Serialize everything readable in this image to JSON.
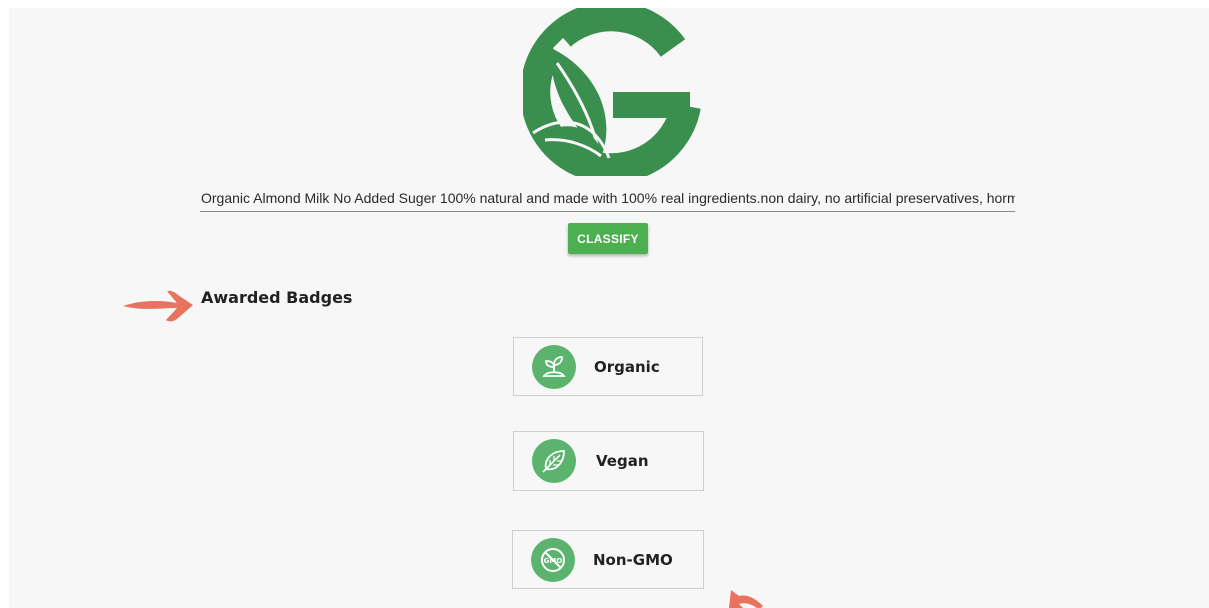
{
  "input": {
    "value": "Organic Almond Milk No Added Suger 100% natural and made with 100% real ingredients.non dairy, no artificial preservatives, hormones, and"
  },
  "actions": {
    "classify_label": "CLASSIFY"
  },
  "badges_section": {
    "title": "Awarded Badges",
    "badges": [
      {
        "label": "Organic",
        "icon": "sprout-icon"
      },
      {
        "label": "Vegan",
        "icon": "leaf-icon"
      },
      {
        "label": "Non-GMO",
        "icon": "no-gmo-icon"
      }
    ]
  },
  "colors": {
    "brand_green": "#3a8f4f",
    "button_green": "#4caf50",
    "badge_icon_green": "#5bb36e",
    "annotation_arrow": "#e8735f"
  }
}
